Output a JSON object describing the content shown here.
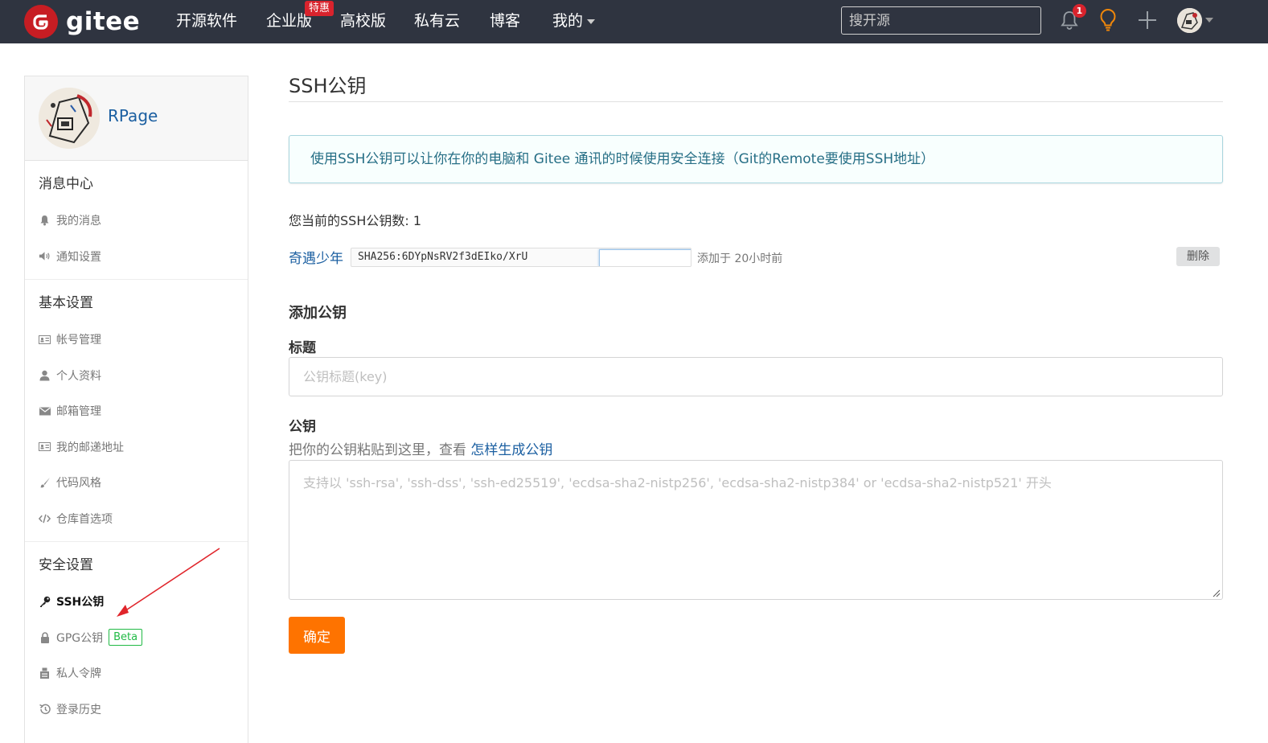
{
  "header": {
    "logo_text": "gitee",
    "nav": [
      "开源软件",
      "企业版",
      "高校版",
      "私有云",
      "博客",
      "我的"
    ],
    "enterprise_badge": "特惠",
    "search_placeholder": "搜开源",
    "notification_count": "1"
  },
  "sidebar": {
    "username": "RPage",
    "sections": [
      {
        "title": "消息中心",
        "items": [
          {
            "label": "我的消息",
            "icon": "bell-icon"
          },
          {
            "label": "通知设置",
            "icon": "speaker-icon"
          }
        ]
      },
      {
        "title": "基本设置",
        "items": [
          {
            "label": "帐号管理",
            "icon": "id-card-icon"
          },
          {
            "label": "个人资料",
            "icon": "user-icon"
          },
          {
            "label": "邮箱管理",
            "icon": "envelope-icon"
          },
          {
            "label": "我的邮递地址",
            "icon": "address-card-icon"
          },
          {
            "label": "代码风格",
            "icon": "brush-icon"
          },
          {
            "label": "仓库首选项",
            "icon": "code-icon"
          }
        ]
      },
      {
        "title": "安全设置",
        "items": [
          {
            "label": "SSH公钥",
            "icon": "key-icon",
            "active": true
          },
          {
            "label": "GPG公钥",
            "icon": "lock-icon",
            "badge": "Beta"
          },
          {
            "label": "私人令牌",
            "icon": "token-icon"
          },
          {
            "label": "登录历史",
            "icon": "history-icon"
          }
        ]
      }
    ]
  },
  "main": {
    "title": "SSH公钥",
    "info": "使用SSH公钥可以让你在你的电脑和 Gitee 通讯的时候使用安全连接（Git的Remote要使用SSH地址）",
    "key_count_text": "您当前的SSH公钥数: 1",
    "keys": [
      {
        "name": "奇遇少年",
        "fingerprint": "SHA256:6DYpNsRV2f3dEIko/XrU",
        "added": "添加于 20小时前",
        "delete_label": "删除"
      }
    ],
    "add_heading": "添加公钥",
    "title_label": "标题",
    "title_placeholder": "公钥标题(key)",
    "key_label": "公钥",
    "hint_prefix": "把你的公钥粘贴到这里，查看 ",
    "hint_link": "怎样生成公钥",
    "key_placeholder": "支持以 'ssh-rsa', 'ssh-dss', 'ssh-ed25519', 'ecdsa-sha2-nistp256', 'ecdsa-sha2-nistp384' or 'ecdsa-sha2-nistp521' 开头",
    "submit_label": "确定"
  },
  "colors": {
    "topbar": "#2f3440",
    "brand_red": "#c71d23",
    "link_blue": "#1b5fa1",
    "submit_orange": "#fe7300",
    "annotation_arrow": "#e0252b"
  }
}
